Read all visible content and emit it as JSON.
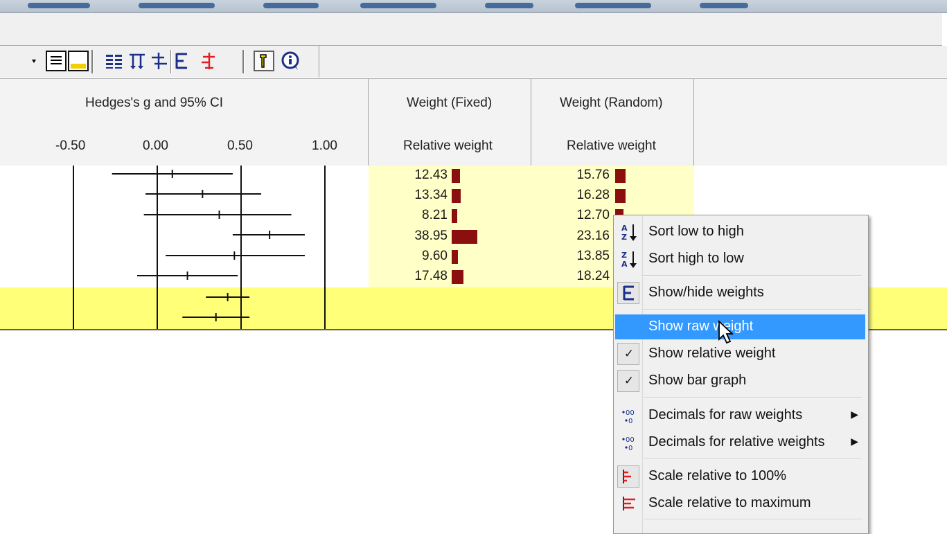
{
  "chart_data": {
    "type": "forest",
    "title": "Hedges's g and 95% CI",
    "x_ticks": [
      "-0.50",
      "0.00",
      "0.50",
      "1.00"
    ],
    "xlim": [
      -1.0,
      1.0
    ],
    "studies": [
      {
        "g": 0.09,
        "lower": -0.27,
        "upper": 0.45
      },
      {
        "g": 0.27,
        "lower": -0.07,
        "upper": 0.62
      },
      {
        "g": 0.37,
        "lower": -0.08,
        "upper": 0.8
      },
      {
        "g": 0.67,
        "lower": 0.45,
        "upper": 0.88
      },
      {
        "g": 0.46,
        "lower": 0.05,
        "upper": 0.88
      },
      {
        "g": 0.18,
        "lower": -0.12,
        "upper": 0.48
      }
    ],
    "summaries": [
      {
        "g": 0.42,
        "lower": 0.29,
        "upper": 0.55
      },
      {
        "g": 0.35,
        "lower": 0.15,
        "upper": 0.55
      }
    ]
  },
  "columns": {
    "fixed": {
      "title": "Weight (Fixed)",
      "subtitle": "Relative weight",
      "values": [
        "12.43",
        "13.34",
        "8.21",
        "38.95",
        "9.60",
        "17.48"
      ],
      "numbers": [
        12.43,
        13.34,
        8.21,
        38.95,
        9.6,
        17.48
      ]
    },
    "random": {
      "title": "Weight (Random)",
      "subtitle": "Relative weight",
      "values": [
        "15.76",
        "16.28",
        "12.70",
        "23.16",
        "13.85",
        "18.24"
      ],
      "numbers": [
        15.76,
        16.28,
        12.7,
        23.16,
        13.85,
        18.24
      ]
    }
  },
  "context_menu": {
    "items": [
      {
        "label": "Sort low to high",
        "icon": "sort-az-icon"
      },
      {
        "label": "Sort high to low",
        "icon": "sort-za-icon"
      },
      {
        "label": "Show/hide  weights",
        "icon": "weights-icon"
      },
      {
        "label": "Show raw weight",
        "highlighted": true
      },
      {
        "label": "Show relative weight",
        "checked": true
      },
      {
        "label": "Show bar graph",
        "checked": true
      },
      {
        "label": "Decimals for raw weights",
        "icon": "decimals-icon",
        "submenu": true
      },
      {
        "label": "Decimals for relative weights",
        "icon": "decimals-icon",
        "submenu": true
      },
      {
        "label": "Scale relative to 100%",
        "icon": "scale-icon"
      },
      {
        "label": "Scale relative to maximum",
        "icon": "scale-icon"
      }
    ],
    "check_glyph": "✓",
    "submenu_glyph": "▶"
  },
  "colors": {
    "bar": "#8b0f0f",
    "highlight": "#3399ff",
    "row_yellow": "#ffff78",
    "col_yellow": "#ffffc8"
  }
}
